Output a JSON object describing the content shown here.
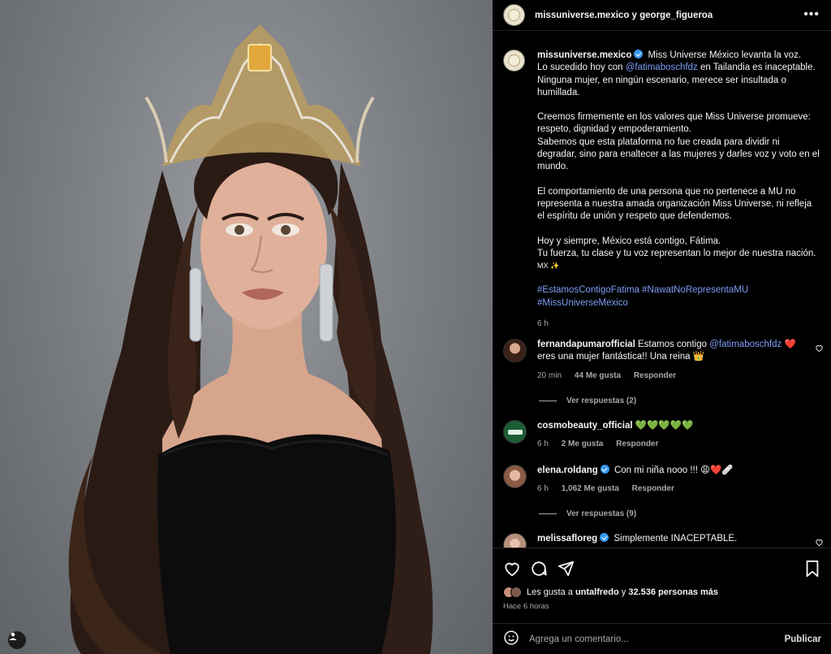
{
  "header": {
    "title": "missuniverse.mexico y george_figueroa",
    "more_icon": "more-horizontal-icon"
  },
  "caption": {
    "username": "missuniverse.mexico",
    "lines": [
      "Miss Universe México levanta la voz.",
      "Lo sucedido hoy con",
      "@fatimaboschfdz",
      "en Tailandia es inaceptable. Ninguna mujer, en ningún escenario, merece ser insultada o humillada.",
      "Creemos firmemente en los valores que Miss Universe promueve: respeto, dignidad y empoderamiento.",
      "Sabemos que esta plataforma no fue creada para dividir ni degradar, sino para enaltecer a las mujeres y darles voz y voto en el mundo.",
      "El comportamiento de una persona que no pertenece a MU no representa a nuestra amada organización Miss Universe, ni refleja el espíritu de unión y respeto que defendemos.",
      "Hoy y siempre, México está contigo, Fátima.",
      "Tu fuerza, tu clase y tu voz representan lo mejor de nuestra nación.",
      "MX ✨"
    ],
    "hashtags": [
      "#EstamosContigoFatima",
      "#NawatNoRepresentaMU",
      "#MissUniverseMexico"
    ],
    "time": "6 h"
  },
  "comments": [
    {
      "username": "fernandapumarofficial",
      "text_before": "Estamos contigo",
      "mention": "@fatimaboschfdz",
      "text_after": "❤️ eres una mujer fantástica!! Una reina 👑",
      "time": "20 min",
      "likes": "44 Me gusta",
      "reply": "Responder",
      "view_replies": "Ver respuestas (2)"
    },
    {
      "username": "cosmobeauty_official",
      "text": "💚💚💚💚💚",
      "time": "6 h",
      "likes": "2 Me gusta",
      "reply": "Responder"
    },
    {
      "username": "elena.roldang",
      "text": "Con mi niña nooo !!! 😩❤️🩹",
      "time": "6 h",
      "likes": "1,062 Me gusta",
      "reply": "Responder",
      "view_replies": "Ver respuestas (9)"
    },
    {
      "username": "melissafloreg",
      "text": "Simplemente INACEPTABLE."
    }
  ],
  "actions": {
    "like_icon": "heart-icon",
    "comment_icon": "comment-icon",
    "share_icon": "send-icon",
    "save_icon": "bookmark-icon"
  },
  "likes": {
    "prefix": "Les gusta a",
    "user": "untalfredo",
    "connector": "y",
    "others": "32.536 personas más"
  },
  "time_ago": "Hace 6 horas",
  "add_comment": {
    "placeholder": "Agrega un comentario...",
    "publish": "Publicar",
    "emoji_icon": "emoji-icon"
  },
  "colors": {
    "background": "#000000",
    "link": "#7c9ff5",
    "muted": "#a8a8a8",
    "verified": "#3897f0",
    "like_red": "#ed4956"
  }
}
